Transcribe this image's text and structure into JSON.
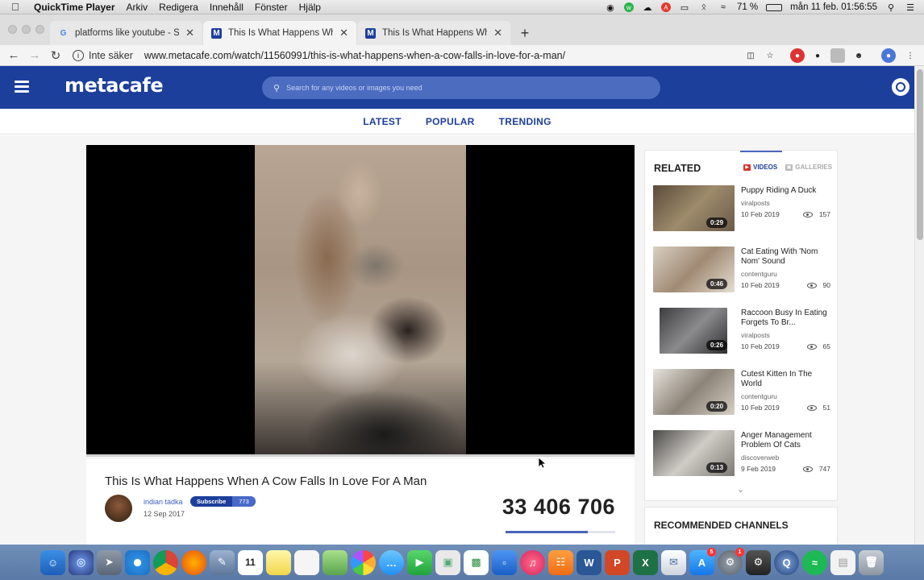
{
  "menubar": {
    "app": "QuickTime Player",
    "items": [
      "Arkiv",
      "Redigera",
      "Innehåll",
      "Fönster",
      "Hjälp"
    ],
    "battery": "71 %",
    "clock": "mån 11 feb. 01:56:55"
  },
  "tabs": [
    {
      "title": "platforms like youtube - Sök på",
      "active": false
    },
    {
      "title": "This Is What Happens When A",
      "active": true
    },
    {
      "title": "This Is What Happens When A",
      "active": false
    }
  ],
  "address": {
    "security": "Inte säker",
    "url": "www.metacafe.com/watch/11560991/this-is-what-happens-when-a-cow-falls-in-love-for-a-man/"
  },
  "site": {
    "logo": "metacafe",
    "search_placeholder": "Search for any videos or images you need",
    "nav": [
      "LATEST",
      "POPULAR",
      "TRENDING"
    ]
  },
  "video": {
    "title": "This Is What Happens When A Cow Falls In Love For A Man",
    "channel": "indian tadka",
    "date": "12 Sep 2017",
    "subscribe_label": "Subscribe",
    "subscribers": "773",
    "views": "33 406 706",
    "view_bar_fraction": 0.75
  },
  "related": {
    "title": "RELATED",
    "tab_videos": "VIDEOS",
    "tab_galleries": "GALLERIES",
    "items": [
      {
        "title": "Puppy Riding A Duck",
        "channel": "viralposts",
        "date": "10 Feb 2019",
        "views": "157",
        "duration": "0:29"
      },
      {
        "title": "Cat Eating With 'Nom Nom' Sound",
        "channel": "contentguru",
        "date": "10 Feb 2019",
        "views": "90",
        "duration": "0:46"
      },
      {
        "title": "Raccoon Busy In Eating Forgets To Br...",
        "channel": "viralposts",
        "date": "10 Feb 2019",
        "views": "65",
        "duration": "0:26"
      },
      {
        "title": "Cutest Kitten In The World",
        "channel": "contentguru",
        "date": "10 Feb 2019",
        "views": "51",
        "duration": "0:20"
      },
      {
        "title": "Anger Management Problem Of Cats",
        "channel": "discoverweb",
        "date": "9 Feb 2019",
        "views": "747",
        "duration": "0:13"
      }
    ]
  },
  "channels": {
    "title": "RECOMMENDED CHANNELS"
  },
  "dock": {
    "calendar_day": "11",
    "badges": {
      "appstore": "5",
      "prefs": "1"
    }
  },
  "colors": {
    "brand": "#1c3f9c",
    "search": "#4c6cc0",
    "dock": "#6082ae"
  }
}
